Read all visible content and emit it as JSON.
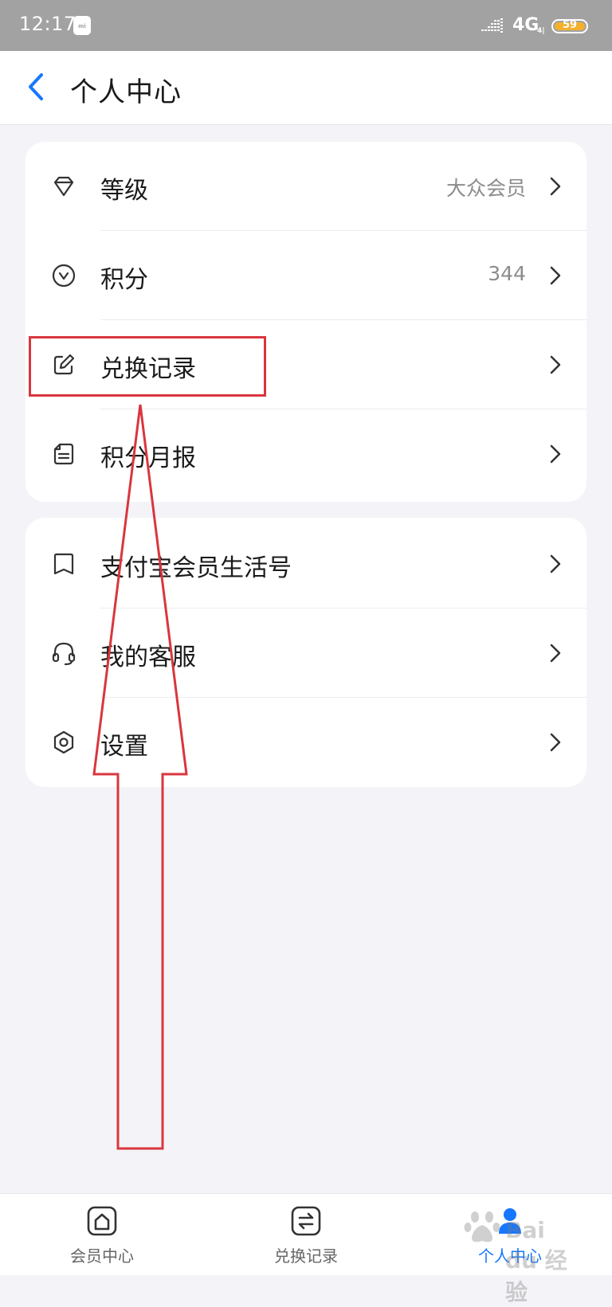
{
  "status_bar": {
    "time": "12:17",
    "carrier_badge": "mi",
    "network": "4G",
    "network_sub": "4‌‌|‌‌",
    "battery": "59"
  },
  "header": {
    "title": "个人中心"
  },
  "cards": [
    {
      "rows": [
        {
          "label": "等级",
          "value": "大众会员",
          "icon": "diamond-icon"
        },
        {
          "label": "积分",
          "value": "344",
          "icon": "points-icon"
        },
        {
          "label": "兑换记录",
          "value": "",
          "icon": "edit-icon"
        },
        {
          "label": "积分月报",
          "value": "",
          "icon": "report-icon"
        }
      ]
    },
    {
      "rows": [
        {
          "label": "支付宝会员生活号",
          "value": "",
          "icon": "bookmark-icon"
        },
        {
          "label": "我的客服",
          "value": "",
          "icon": "headset-icon"
        },
        {
          "label": "设置",
          "value": "",
          "icon": "settings-icon"
        }
      ]
    }
  ],
  "bottom_nav": [
    {
      "label": "会员中心",
      "icon": "home-icon",
      "active": false
    },
    {
      "label": "兑换记录",
      "icon": "exchange-icon",
      "active": false
    },
    {
      "label": "个人中心",
      "icon": "user-icon",
      "active": true
    }
  ],
  "watermark": {
    "text": "Bai du 经验"
  },
  "colors": {
    "accent": "#1677ff",
    "annotation": "#d9363e",
    "status_bar": "#a2a2a2",
    "battery": "#f3b02c"
  }
}
